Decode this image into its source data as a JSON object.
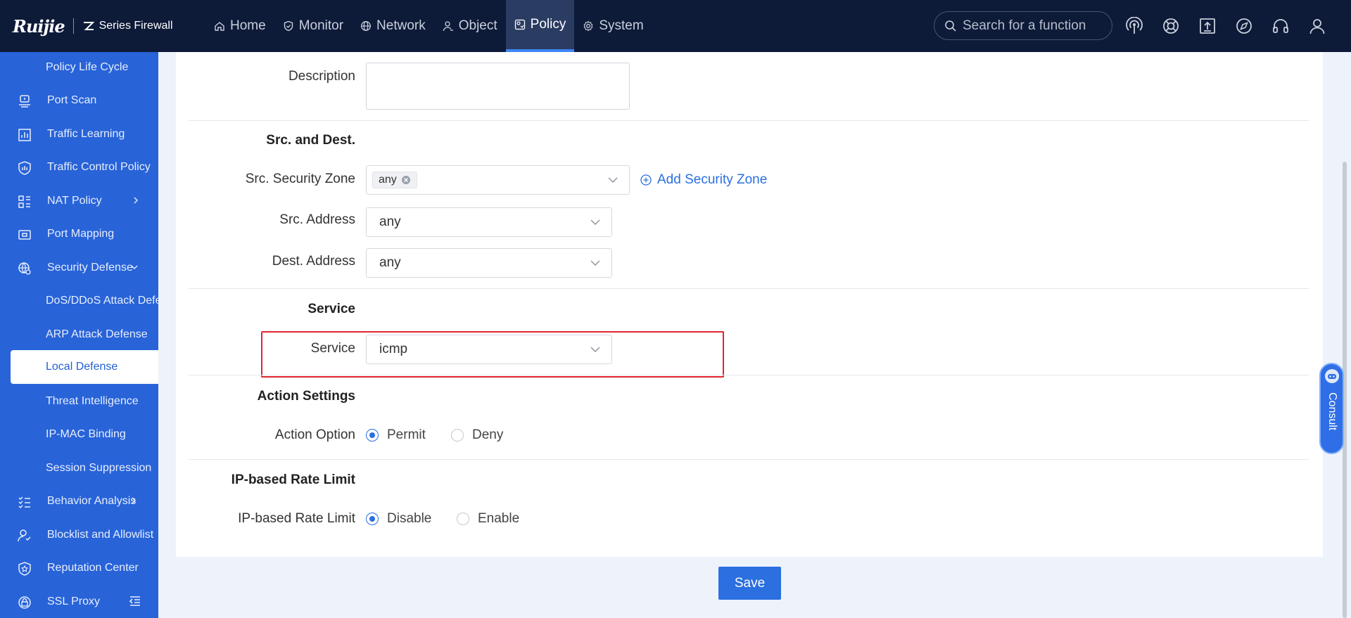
{
  "header": {
    "brand": "Ruijie",
    "product": "Series Firewall",
    "nav": [
      {
        "label": "Home",
        "icon": "home-icon"
      },
      {
        "label": "Monitor",
        "icon": "shield-icon"
      },
      {
        "label": "Network",
        "icon": "globe-icon"
      },
      {
        "label": "Object",
        "icon": "user-icon"
      },
      {
        "label": "Policy",
        "icon": "policy-icon",
        "active": true
      },
      {
        "label": "System",
        "icon": "gear-icon"
      }
    ],
    "search_placeholder": "Search for a function",
    "icons": [
      "signal-icon",
      "help-icon",
      "upload-icon",
      "compass-icon",
      "headset-icon",
      "account-icon"
    ]
  },
  "sidebar": {
    "items": [
      {
        "label": "Policy Life Cycle"
      },
      {
        "label": "Port Scan",
        "icon": "scan-icon"
      },
      {
        "label": "Traffic Learning",
        "icon": "chart-icon"
      },
      {
        "label": "Traffic Control Policy",
        "icon": "control-icon"
      },
      {
        "label": "NAT Policy",
        "icon": "nat-icon"
      },
      {
        "label": "Port Mapping",
        "icon": "mapping-icon"
      },
      {
        "label": "Security Defense",
        "icon": "security-icon"
      },
      {
        "label": "DoS/DDoS Attack Defense"
      },
      {
        "label": "ARP Attack Defense"
      },
      {
        "label": "Local Defense",
        "active": true
      },
      {
        "label": "Threat Intelligence"
      },
      {
        "label": "IP-MAC Binding"
      },
      {
        "label": "Session Suppression"
      },
      {
        "label": "Behavior Analysis",
        "icon": "behavior-icon"
      },
      {
        "label": "Blocklist and Allowlist",
        "icon": "blocklist-icon"
      },
      {
        "label": "Reputation Center",
        "icon": "reputation-icon"
      },
      {
        "label": "SSL Proxy",
        "icon": "ssl-icon"
      }
    ]
  },
  "form": {
    "description_label": "Description",
    "description_value": "",
    "src_dest_section": "Src. and Dest.",
    "src_zone_label": "Src. Security Zone",
    "src_zone_tag": "any",
    "add_zone_link": "Add Security Zone",
    "src_address_label": "Src. Address",
    "src_address_value": "any",
    "dest_address_label": "Dest. Address",
    "dest_address_value": "any",
    "service_section": "Service",
    "service_label": "Service",
    "service_value": "icmp",
    "action_section": "Action Settings",
    "action_label": "Action Option",
    "action_options": [
      "Permit",
      "Deny"
    ],
    "action_selected": "Permit",
    "rate_section": "IP-based Rate Limit",
    "rate_label": "IP-based Rate Limit",
    "rate_options": [
      "Disable",
      "Enable"
    ],
    "rate_selected": "Disable"
  },
  "save_label": "Save",
  "consult_label": "Consult",
  "colors": {
    "topbar": "#0d1a38",
    "sidebar": "#2863d8",
    "accent": "#2b6fe0",
    "highlight": "#e0252e"
  }
}
